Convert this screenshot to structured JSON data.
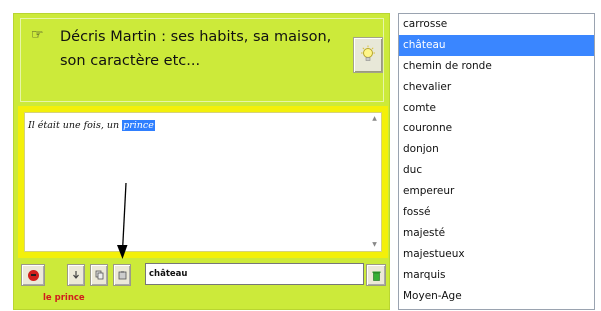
{
  "prompt": {
    "text": "Décris Martin : ses habits, sa maison, son caractère etc...",
    "icon": "pointing-hand-icon",
    "hint_icon": "lightbulb-icon"
  },
  "story": {
    "text_before": "Il était une fois, un ",
    "selected_word": "prince"
  },
  "toolbar": {
    "speak_icon": "speaker-icon",
    "word_field_value": "château",
    "status_label": "le prince"
  },
  "word_list": {
    "items": [
      "carrosse",
      "château",
      "chemin de ronde",
      "chevalier",
      "comte",
      "couronne",
      "donjon",
      "duc",
      "empereur",
      "fossé",
      "majesté",
      "majestueux",
      "marquis",
      "Moyen-Age"
    ],
    "selected_index": 1
  },
  "colors": {
    "panel": "#ccea3a",
    "text_frame": "#f3f00a",
    "selection": "#3a86ff",
    "status": "#d01d1d"
  }
}
